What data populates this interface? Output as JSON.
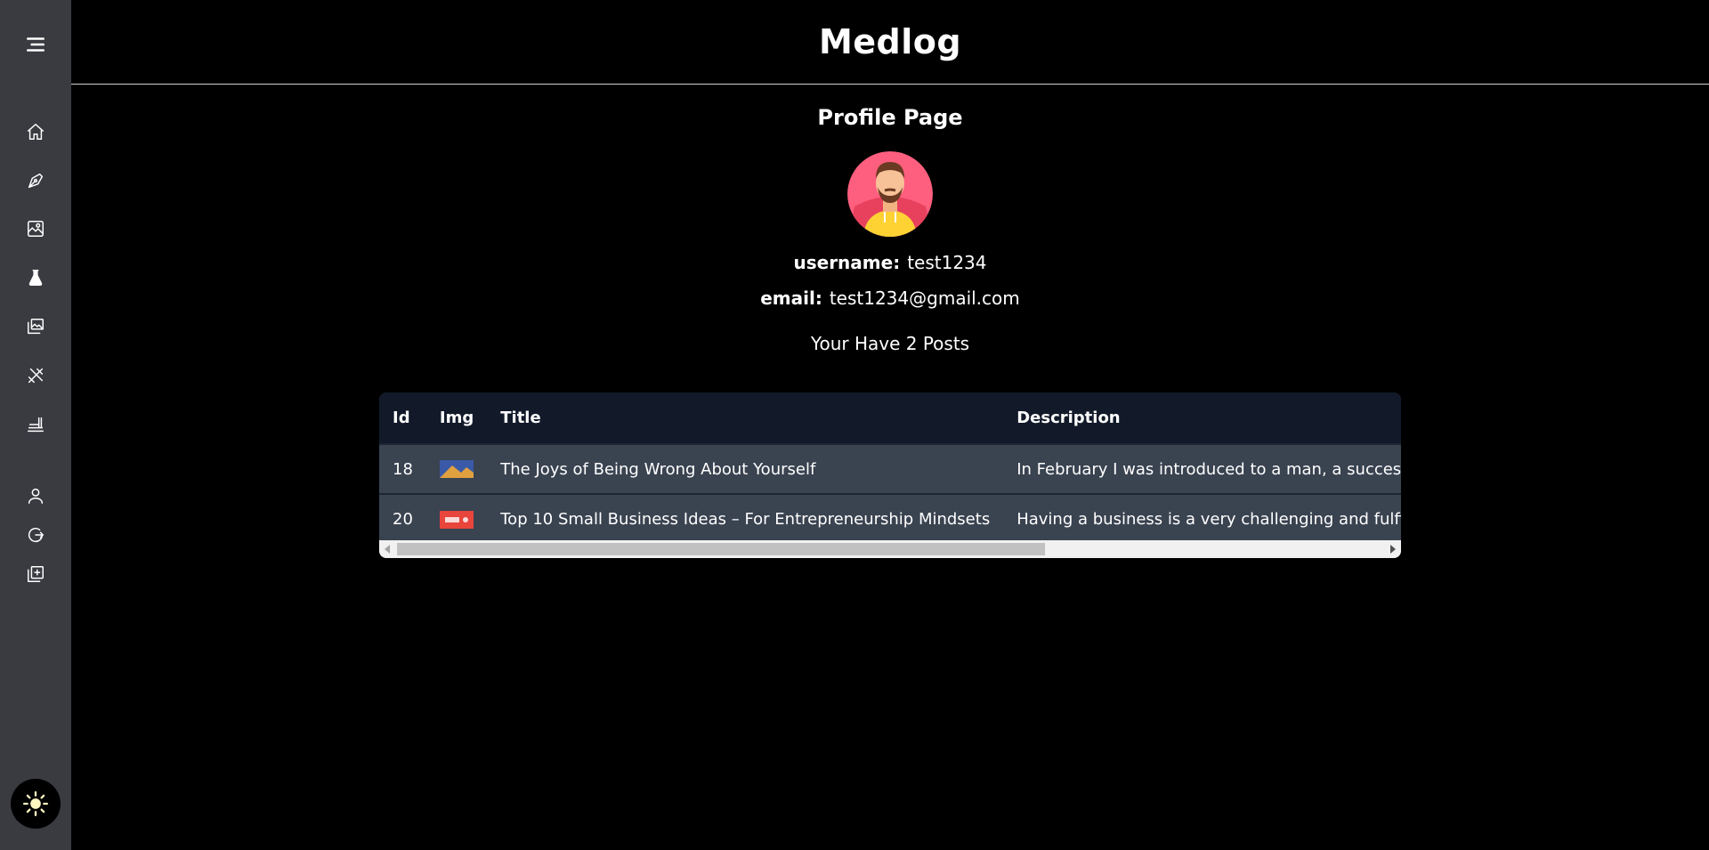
{
  "header": {
    "title": "Medlog"
  },
  "sidebar": {
    "items": [
      {
        "icon": "menu-icon"
      },
      {
        "icon": "home-icon"
      },
      {
        "icon": "pen-icon"
      },
      {
        "icon": "image-edit-icon"
      },
      {
        "icon": "flask-icon"
      },
      {
        "icon": "gallery-icon"
      },
      {
        "icon": "tools-icon"
      },
      {
        "icon": "food-icon"
      },
      {
        "icon": "user-icon"
      },
      {
        "icon": "logout-icon"
      },
      {
        "icon": "add-post-icon"
      },
      {
        "icon": "sun-icon"
      }
    ]
  },
  "profile": {
    "page_title": "Profile Page",
    "username_label": "username:",
    "username": "test1234",
    "email_label": "email:",
    "email": "test1234@gmail.com",
    "posts_text": "Your Have 2 Posts"
  },
  "table": {
    "headers": [
      "Id",
      "Img",
      "Title",
      "Description"
    ],
    "rows": [
      {
        "id": "18",
        "title": "The Joys of Being Wrong About Yourself",
        "description": "In February I was introduced to a man, a successful"
      },
      {
        "id": "20",
        "title": "Top 10 Small Business Ideas – For Entrepreneurship Mindsets",
        "description": "Having a business is a very challenging and fulfilling"
      }
    ]
  },
  "colors": {
    "sidebar": "#3a3b41",
    "table_header": "#121a2a",
    "table_row": "#3a4350"
  }
}
